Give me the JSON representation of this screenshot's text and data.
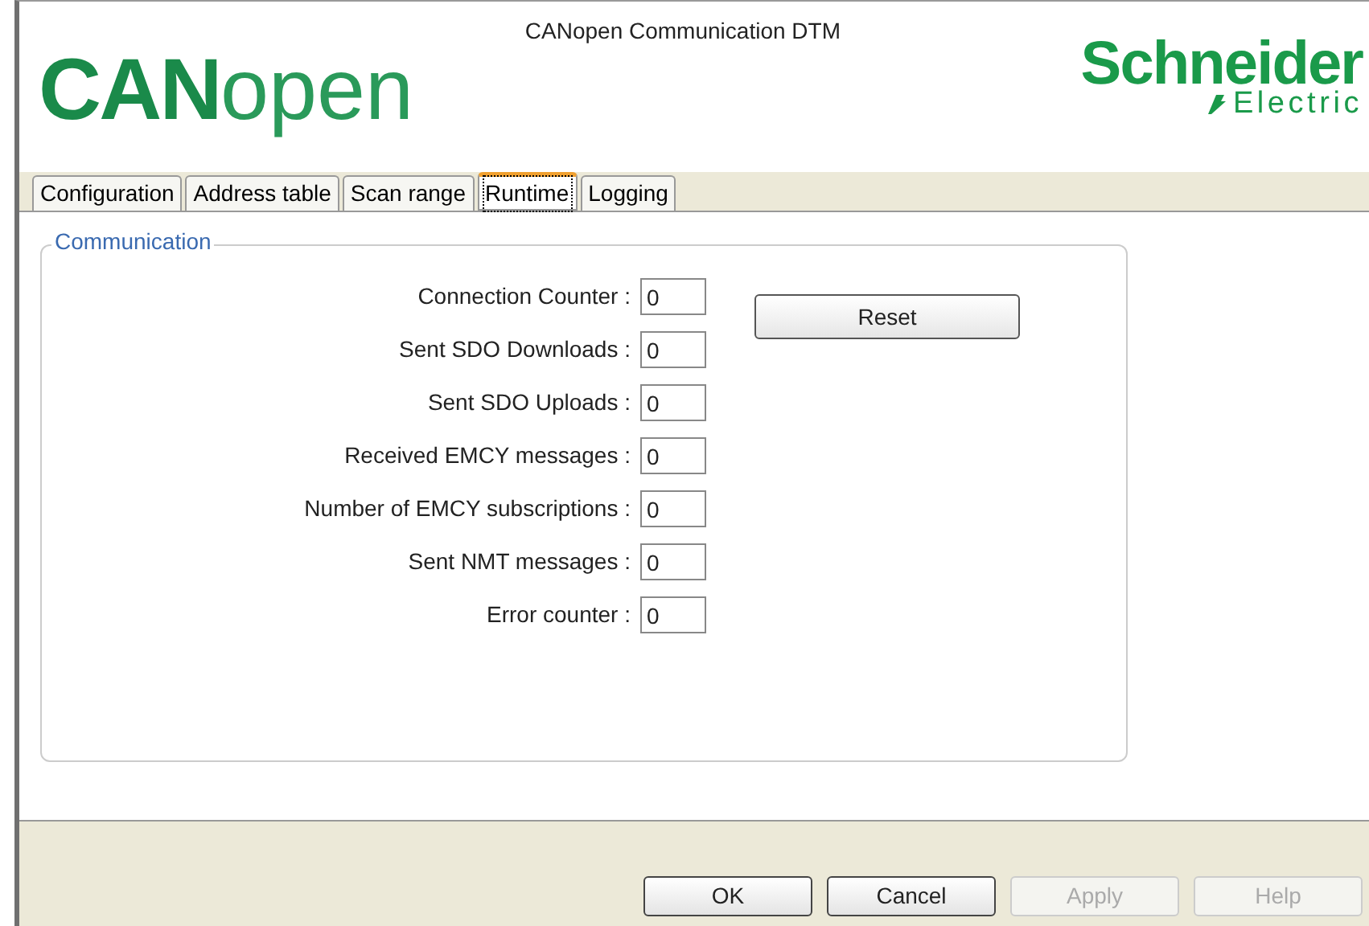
{
  "window": {
    "title": "CANopen Communication DTM"
  },
  "logo": {
    "bold": "CAN",
    "light": "open"
  },
  "brand": {
    "name": "Schneider",
    "sub": "Electric"
  },
  "tabs": [
    {
      "label": "Configuration",
      "selected": false
    },
    {
      "label": "Address table",
      "selected": false
    },
    {
      "label": "Scan range",
      "selected": false
    },
    {
      "label": "Runtime",
      "selected": true
    },
    {
      "label": "Logging",
      "selected": false
    }
  ],
  "group": {
    "title": "Communication",
    "fields": [
      {
        "label": "Connection Counter :",
        "value": "0"
      },
      {
        "label": "Sent SDO Downloads :",
        "value": "0"
      },
      {
        "label": "Sent SDO Uploads :",
        "value": "0"
      },
      {
        "label": "Received EMCY messages :",
        "value": "0"
      },
      {
        "label": "Number of EMCY subscriptions :",
        "value": "0"
      },
      {
        "label": "Sent NMT messages :",
        "value": "0"
      },
      {
        "label": "Error counter :",
        "value": "0"
      }
    ],
    "reset_button": "Reset"
  },
  "buttons": [
    {
      "label": "OK",
      "disabled": false
    },
    {
      "label": "Cancel",
      "disabled": false
    },
    {
      "label": "Apply",
      "disabled": true
    },
    {
      "label": "Help",
      "disabled": true
    }
  ]
}
